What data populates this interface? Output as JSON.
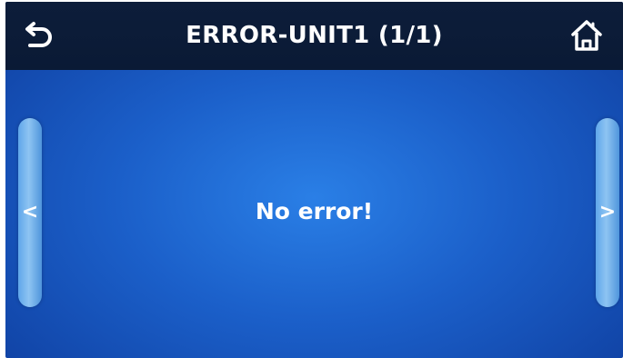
{
  "header": {
    "title": "ERROR-UNIT1 (1/1)"
  },
  "icons": {
    "back": "back-arrow-icon",
    "home": "home-icon",
    "prev": "chevron-left-icon",
    "next": "chevron-right-icon"
  },
  "nav": {
    "prev_glyph": "<",
    "next_glyph": ">"
  },
  "main": {
    "message": "No error!"
  },
  "colors": {
    "background": "#1b5fc9",
    "header": "#0d1d3a",
    "text": "#ffffff",
    "side_button": "#6fb0ee"
  }
}
